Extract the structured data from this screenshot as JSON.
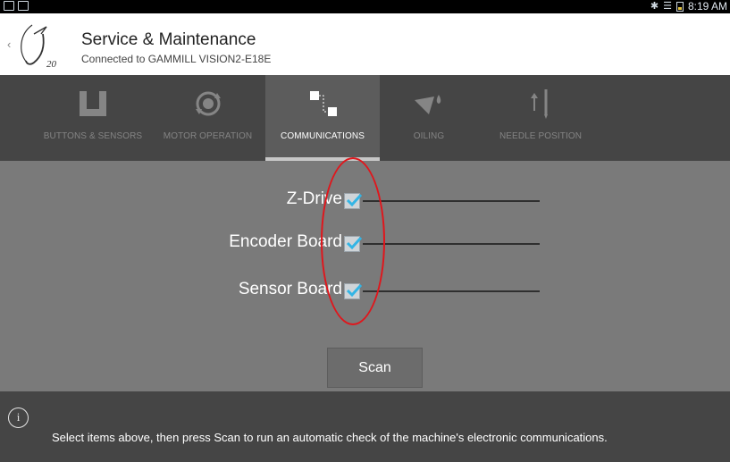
{
  "status_bar": {
    "time": "8:19 AM",
    "left_icons": [
      "screen-cast-icon",
      "gallery-icon"
    ],
    "right_icons": [
      "bluetooth-icon",
      "wifi-icon",
      "battery-icon"
    ],
    "battery_color": "#e5c440"
  },
  "header": {
    "title": "Service & Maintenance",
    "subtitle": "Connected to GAMMILL VISION2-E18E",
    "logo_text": "20"
  },
  "tabs": [
    {
      "label": "BUTTONS & SENSORS",
      "icon": "buttons-sensors-icon",
      "active": false
    },
    {
      "label": "MOTOR OPERATION",
      "icon": "motor-operation-icon",
      "active": false
    },
    {
      "label": "COMMUNICATIONS",
      "icon": "communications-icon",
      "active": true
    },
    {
      "label": "OILING",
      "icon": "oiling-icon",
      "active": false
    },
    {
      "label": "NEEDLE POSITION",
      "icon": "needle-position-icon",
      "active": false
    }
  ],
  "items": [
    {
      "label": "Z-Drive",
      "checked": true,
      "progress": 0
    },
    {
      "label": "Encoder Board",
      "checked": true,
      "progress": 0
    },
    {
      "label": "Sensor Board",
      "checked": true,
      "progress": 0
    }
  ],
  "scan_button": {
    "label": "Scan"
  },
  "info": {
    "icon": "info-icon",
    "glyph": "i",
    "text": "Select items above, then press Scan to run an automatic check of the machine's electronic communications."
  },
  "colors": {
    "accent": "#33b5e5",
    "annotation": "#e0161c",
    "tab_bar": "#454545",
    "content_background": "#7a7a7a"
  }
}
